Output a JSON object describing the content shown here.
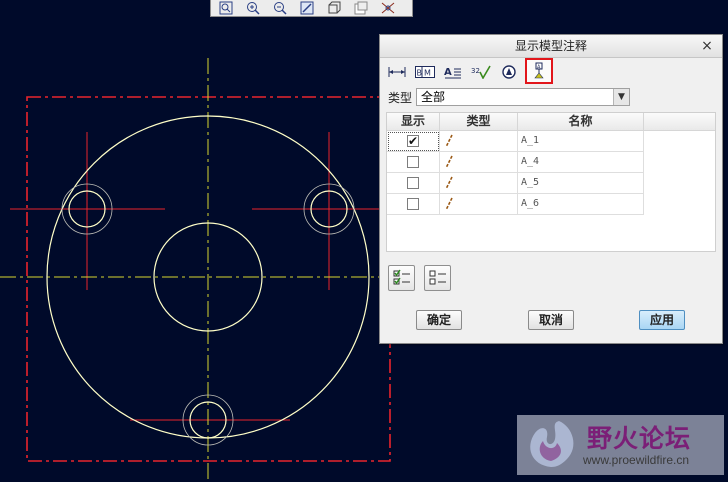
{
  "toolbar": {
    "buttons": [
      {
        "name": "zoom-fit-icon"
      },
      {
        "name": "zoom-in-icon"
      },
      {
        "name": "zoom-out-icon"
      },
      {
        "name": "repaint-icon"
      },
      {
        "name": "orient-icon"
      },
      {
        "name": "saved-views-icon"
      },
      {
        "name": "display-style-icon"
      }
    ]
  },
  "dialog": {
    "title": "显示模型注释",
    "close_glyph": "×",
    "tabs": [
      {
        "icon": "dimension-tab-icon"
      },
      {
        "icon": "geometric-tolerance-tab-icon"
      },
      {
        "icon": "note-tab-icon"
      },
      {
        "icon": "surface-finish-tab-icon"
      },
      {
        "icon": "symbol-tab-icon"
      },
      {
        "icon": "datum-tab-icon",
        "active": true
      }
    ],
    "type_label": "类型",
    "type_value": "全部",
    "columns": {
      "show": "显示",
      "type": "类型",
      "name": "名称"
    },
    "rows": [
      {
        "name": "A_1",
        "checked": true
      },
      {
        "name": "A_4",
        "checked": false
      },
      {
        "name": "A_5",
        "checked": false
      },
      {
        "name": "A_6",
        "checked": false
      }
    ],
    "buttons": {
      "ok": "确定",
      "cancel": "取消",
      "apply": "应用"
    }
  },
  "colors": {
    "background": "#000a2a",
    "outline": "#ffffc8",
    "axis": "#d7d730",
    "datum": "#e8242c",
    "dialog_highlight": "#e2161b",
    "watermark_text": "#7b1f77"
  },
  "watermark": {
    "title": "野火论坛",
    "url": "www.proewildfire.cn"
  }
}
